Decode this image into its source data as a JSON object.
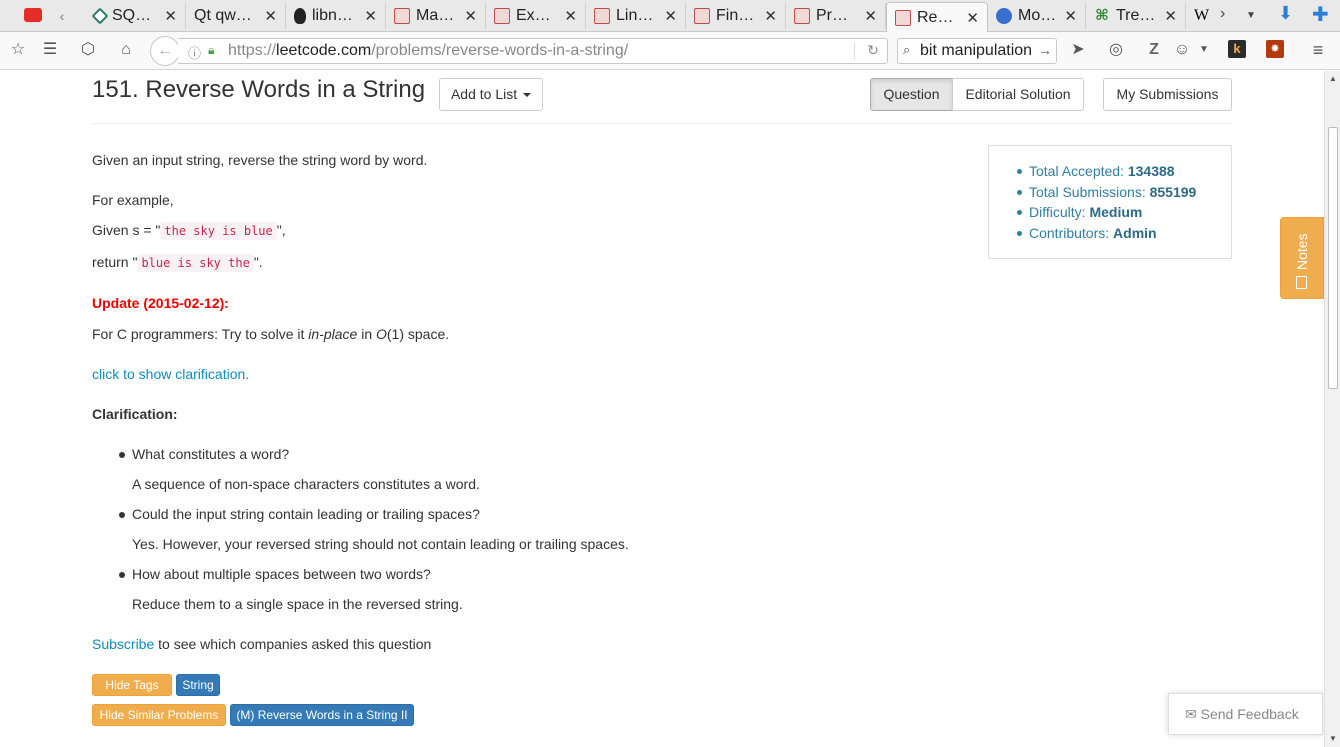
{
  "browser": {
    "tabs": [
      {
        "label": "SQ…",
        "favicon": "diamond-icon",
        "color": "#2d7a6e"
      },
      {
        "label": "Qt qw…",
        "favicon": "qt-icon",
        "color": "#41cd52"
      },
      {
        "label": "libn…",
        "favicon": "tux-icon",
        "color": "#222222"
      },
      {
        "label": "Ma…",
        "favicon": "leetcode-icon",
        "color": "#c04b4b"
      },
      {
        "label": "Ex…",
        "favicon": "leetcode-icon",
        "color": "#c04b4b"
      },
      {
        "label": "Lin…",
        "favicon": "leetcode-icon",
        "color": "#c04b4b"
      },
      {
        "label": "Fin…",
        "favicon": "leetcode-icon",
        "color": "#c04b4b"
      },
      {
        "label": "Pr…",
        "favicon": "leetcode-icon",
        "color": "#c04b4b"
      },
      {
        "label": "Re…",
        "favicon": "leetcode-icon",
        "color": "#c04b4b",
        "active": true
      },
      {
        "label": "Mo…",
        "favicon": "mozilla-icon",
        "color": "#3a6fd0"
      },
      {
        "label": "Tre…",
        "favicon": "tree-icon",
        "color": "#2a8a2a"
      },
      {
        "label": "W",
        "favicon": "wikipedia-icon",
        "color": "#000000"
      }
    ],
    "url_prefix": "https://",
    "url_host": "leetcode.com",
    "url_path": "/problems/reverse-words-in-a-string/",
    "search_value": "bit manipulation"
  },
  "problem": {
    "title": "151. Reverse Words in a String",
    "add_to_list": "Add to List",
    "tabs": {
      "question": "Question",
      "editorial": "Editorial Solution",
      "submissions": "My Submissions"
    },
    "desc": "Given an input string, reverse the string word by word.",
    "for_example": "For example,",
    "given_prefix": "Given s = \"",
    "given_code": "the sky is blue",
    "given_suffix": "\",",
    "return_prefix": "return \"",
    "return_code": "blue is sky the",
    "return_suffix": "\".",
    "update_label": "Update (2015-02-12):",
    "update_text_1": "For C programmers: Try to solve it ",
    "update_em_1": "in-place",
    "update_text_2": " in ",
    "update_em_2": "O",
    "update_text_3": "(1) space.",
    "clarify_link": "click to show clarification.",
    "clarification_title": "Clarification:",
    "clarifications": [
      {
        "q": "What constitutes a word?",
        "a": "A sequence of non-space characters constitutes a word."
      },
      {
        "q": "Could the input string contain leading or trailing spaces?",
        "a": "Yes. However, your reversed string should not contain leading or trailing spaces."
      },
      {
        "q": "How about multiple spaces between two words?",
        "a": "Reduce them to a single space in the reversed string."
      }
    ],
    "subscribe_link": "Subscribe",
    "subscribe_text": " to see which companies asked this question",
    "hide_tags": "Hide Tags",
    "tag_string": "String",
    "hide_similar": "Hide Similar Problems",
    "similar_1": "(M) Reverse Words in a String II"
  },
  "stats": {
    "accepted_label": "Total Accepted: ",
    "accepted": "134388",
    "submissions_label": "Total Submissions: ",
    "submissions": "855199",
    "difficulty_label": "Difficulty: ",
    "difficulty": "Medium",
    "contributors_label": "Contributors: ",
    "contributors": "Admin"
  },
  "notes_label": "Notes",
  "feedback_label": "Send Feedback"
}
